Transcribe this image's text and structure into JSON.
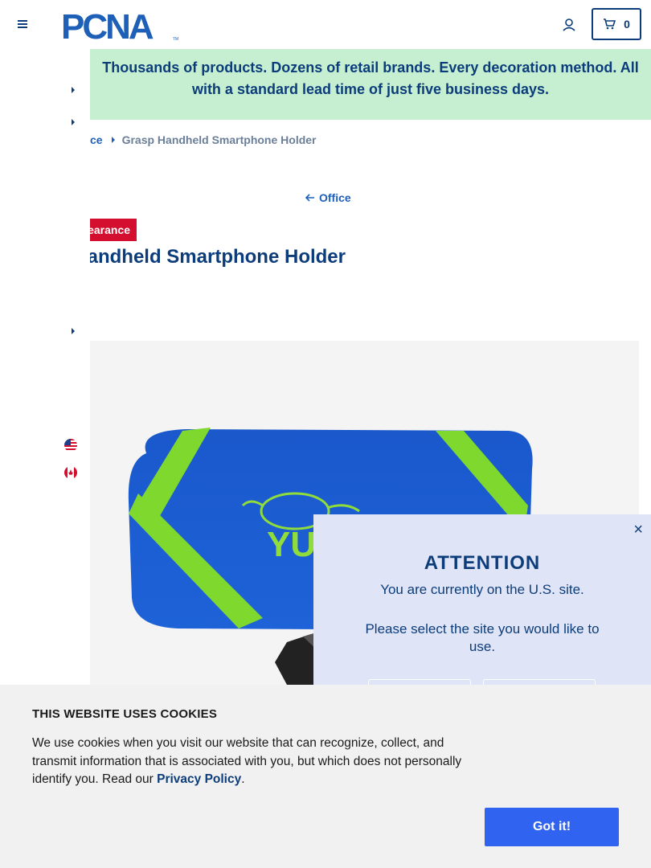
{
  "header": {
    "logo_text": "PCNA",
    "logo_tm": "TM",
    "cart_count": "0"
  },
  "banner": {
    "text": "Thousands of products. Dozens of retail brands. Every decoration method. All with a standard lead time of just five business days."
  },
  "breadcrumb": {
    "parent": "ce",
    "current": "Grasp Handheld Smartphone Holder"
  },
  "back_link": {
    "label": "Office"
  },
  "product": {
    "badge": "Clearance",
    "title": "Grasp Handheld Smartphone Holder",
    "colors": {
      "pouch": "#1f5fd6",
      "strap": "#7fd82e",
      "imprint": "#8fdc3a"
    }
  },
  "attention_modal": {
    "close_label": "×",
    "title": "ATTENTION",
    "line1": "You are currently on the U.S. site.",
    "line2": "Please select the site you would like to use."
  },
  "cookie_banner": {
    "title": "THIS WEBSITE USES COOKIES",
    "text": "We use cookies when you visit our website that can recognize, collect, and transmit information that is associated with you, but which does not personally identify you. Read our",
    "link": "Privacy Policy",
    "period": ".",
    "button": "Got it!"
  },
  "colors": {
    "navy": "#0c3d7a",
    "link_blue": "#1e5fb8",
    "banner_green": "#c6efd2",
    "clearance_red": "#d40e2e",
    "modal_bg": "#dfe4f7",
    "cookie_btn": "#2f63f0"
  }
}
